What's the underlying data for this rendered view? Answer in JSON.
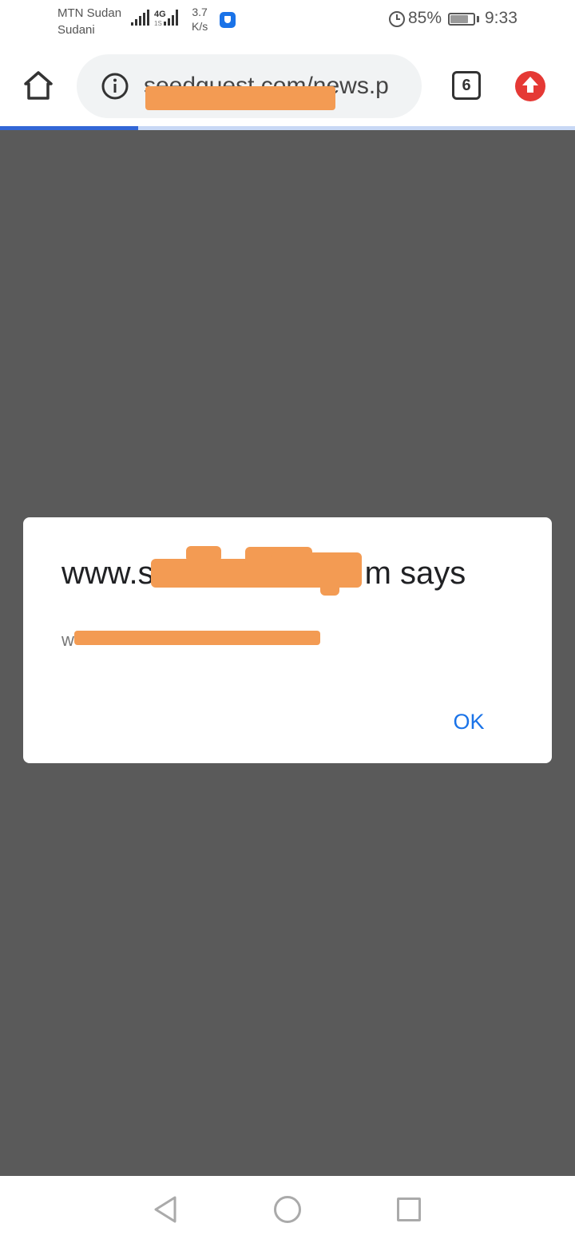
{
  "status_bar": {
    "carrier_line1": "MTN Sudan",
    "carrier_line2": "Sudani",
    "network_type": "4G",
    "network_sub": "1S",
    "speed_value": "3.7",
    "speed_unit": "K/s",
    "battery_percent": "85%",
    "battery_level": 0.85,
    "time": "9:33"
  },
  "browser": {
    "url_visible": "seedquest.com/news.p",
    "tab_count": "6",
    "page_load_progress": 0.24
  },
  "dialog": {
    "title_prefix": "www.s",
    "title_suffix": "m says",
    "message_prefix": "w",
    "ok_label": "OK"
  },
  "colors": {
    "page_dim": "#5a5a5a",
    "accent": "#1a73e8",
    "redaction": "#f39b53",
    "update_badge": "#e53935"
  },
  "icons": {
    "home": "home-icon",
    "info": "info-icon",
    "update": "update-arrow-icon",
    "back": "nav-back-icon",
    "nav_home": "nav-home-icon",
    "recents": "nav-recents-icon"
  }
}
